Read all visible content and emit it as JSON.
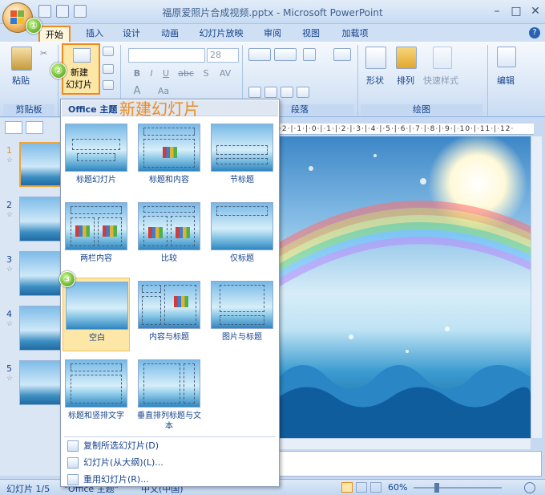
{
  "window": {
    "title": "福原爱照片合成视频.pptx - Microsoft PowerPoint",
    "minimize": "–",
    "maximize": "□",
    "close": "✕"
  },
  "tabs": [
    "开始",
    "插入",
    "设计",
    "动画",
    "幻灯片放映",
    "审阅",
    "视图",
    "加载项"
  ],
  "active_tab": "开始",
  "ribbon": {
    "clipboard": {
      "paste": "粘贴",
      "label": "剪贴板"
    },
    "slides": {
      "new_slide_line1": "新建",
      "new_slide_line2": "幻灯片",
      "arrow": "▾"
    },
    "font": {
      "size": "28",
      "bold": "B",
      "italic": "I",
      "underline": "U",
      "strike": "abc",
      "shadow": "S",
      "spacing": "AV",
      "font_a": "A",
      "font_aa": "Aa"
    },
    "paragraph": {
      "label": "段落"
    },
    "drawing": {
      "shapes": "形状",
      "arrange": "排列",
      "quick_styles": "快速样式",
      "label": "绘图"
    },
    "editing": {
      "label": "编辑"
    }
  },
  "annotation_title": "新建幻灯片",
  "gallery": {
    "header": "Office 主题",
    "layouts": [
      {
        "label": "标题幻灯片"
      },
      {
        "label": "标题和内容"
      },
      {
        "label": "节标题"
      },
      {
        "label": "两栏内容"
      },
      {
        "label": "比较"
      },
      {
        "label": "仅标题"
      },
      {
        "label": "空白"
      },
      {
        "label": "内容与标题"
      },
      {
        "label": "图片与标题"
      },
      {
        "label": "标题和竖排文字"
      },
      {
        "label": "垂直排列标题与文本"
      }
    ],
    "menu": [
      {
        "label": "复制所选幻灯片(D)"
      },
      {
        "label": "幻灯片(从大纲)(L)..."
      },
      {
        "label": "重用幻灯片(R)..."
      }
    ]
  },
  "badges": [
    "①",
    "②",
    "③"
  ],
  "slide_numbers": [
    "1",
    "2",
    "3",
    "4",
    "5"
  ],
  "ruler": "·2·|·1·|·0·|·1·|·2·|·3·|·4·|·5·|·6·|·7·|·8·|·9·|·10·|·11·|·12·",
  "status": {
    "slide": "幻灯片 1/5",
    "theme": "\"Office 主题\"",
    "language": "中文(中国)",
    "zoom": "60%"
  },
  "colors": {
    "accent": "#f08a1c",
    "ribbon_text": "#15428b",
    "badge": "#4c9d15"
  }
}
